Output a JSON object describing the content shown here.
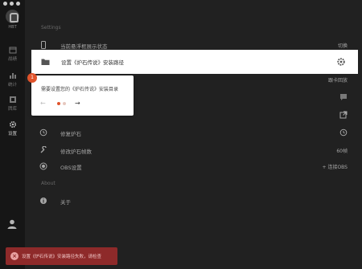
{
  "sidebar": {
    "app_name": "HBT",
    "items": [
      {
        "label": "战绩",
        "icon": "calendar-icon"
      },
      {
        "label": "统计",
        "icon": "bar-chart-icon"
      },
      {
        "label": "牌库",
        "icon": "cards-icon"
      },
      {
        "label": "设置",
        "icon": "gear-icon",
        "active": true
      }
    ],
    "bottom_icon": "person-icon"
  },
  "sections": {
    "settings_title": "Settings",
    "about_title": "About"
  },
  "rows": [
    {
      "label": "当前悬浮框展示状态",
      "right": "切换",
      "icon": "phone-icon"
    },
    {
      "label": "设置《炉石传说》安装路径",
      "right": "",
      "icon": "folder-icon",
      "highlighted": true
    },
    {
      "label": "",
      "right": "跟卡回放",
      "icon": "",
      "partial": true
    },
    {
      "label": "",
      "right": "",
      "icon": "",
      "right_icon": "chat-icon"
    },
    {
      "label": "",
      "right": "",
      "icon": "",
      "right_icon": "open-external-icon"
    },
    {
      "label": "修复炉石",
      "right": "",
      "icon": "history-icon",
      "right_icon": "history-icon"
    },
    {
      "label": "修改炉石帧数",
      "right": "60帧",
      "icon": "wrench-icon"
    },
    {
      "label": "OBS设置",
      "right": "+ 连接OBS",
      "icon": "target-icon"
    },
    {
      "label": "关于",
      "right": "",
      "icon": "info-icon"
    }
  ],
  "highlight": {
    "label": "设置《炉石传说》安装路径",
    "gear_icon": "gear-icon"
  },
  "tooltip": {
    "step": "1",
    "text": "需要设置您的《炉石传说》安装目录",
    "prev": "←",
    "next": "→"
  },
  "toast": {
    "text": "设置《炉石传说》安装路径失败，请检查"
  }
}
